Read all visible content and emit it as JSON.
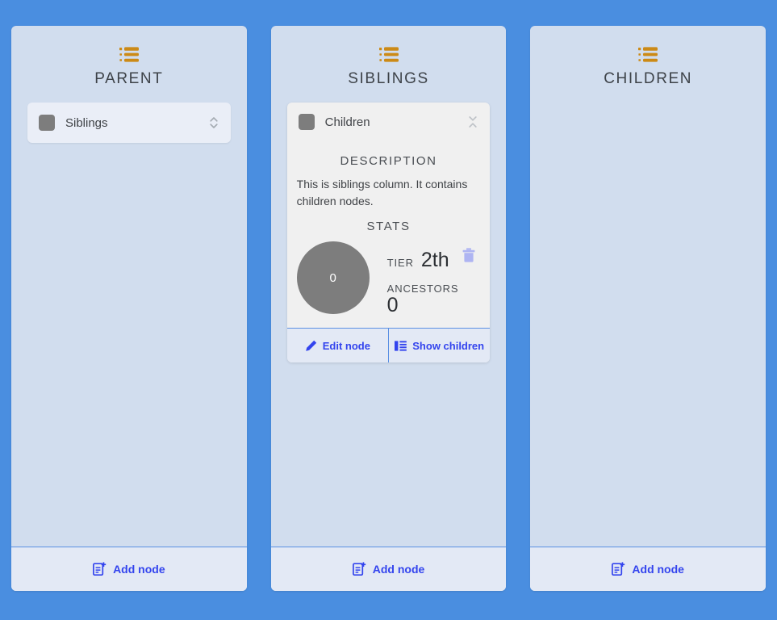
{
  "theme": {
    "background": "#4a8ee0",
    "column_bg": "#d1ddee",
    "card_bg": "#f0f0f0",
    "accent_blue": "#3344ee",
    "header_icon_color": "#cc8a16",
    "swatch_gray": "#7d7d7d",
    "footer_bg": "#e3e9f5",
    "trash_color": "#aeb4f2"
  },
  "columns": [
    {
      "id": "parent",
      "title": "PARENT",
      "icon": "list-icon",
      "footer": {
        "label": "Add node",
        "icon": "add-node-icon"
      },
      "nodes": [
        {
          "label": "Siblings",
          "swatch": "#7d7d7d",
          "toggle_icon": "expand-icon"
        }
      ]
    },
    {
      "id": "siblings",
      "title": "SIBLINGS",
      "icon": "list-icon",
      "footer": {
        "label": "Add node",
        "icon": "add-node-icon"
      },
      "card": {
        "title": "Children",
        "swatch": "#7d7d7d",
        "toggle_icon": "collapse-icon",
        "description_heading": "DESCRIPTION",
        "description": "This is siblings column. It contains children nodes.",
        "stats_heading": "STATS",
        "circle_value": "0",
        "tier_label": "TIER",
        "tier_value": "2th",
        "ancestors_label": "ANCESTORS",
        "ancestors_value": "0",
        "delete_icon": "trash-icon",
        "actions": [
          {
            "label": "Edit node",
            "icon": "pencil-icon"
          },
          {
            "label": "Show children",
            "icon": "columns-icon"
          }
        ]
      }
    },
    {
      "id": "children",
      "title": "CHILDREN",
      "icon": "list-icon",
      "footer": {
        "label": "Add node",
        "icon": "add-node-icon"
      },
      "nodes": []
    }
  ]
}
